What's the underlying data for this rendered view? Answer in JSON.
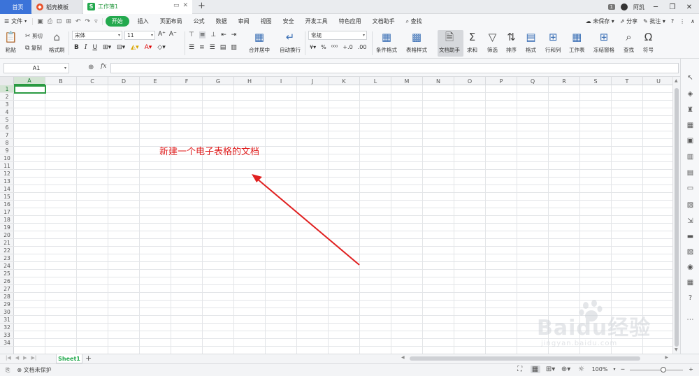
{
  "titlebar": {
    "tabs": [
      {
        "label": "首页"
      },
      {
        "label": "稻壳模板"
      },
      {
        "label": "工作簿1"
      }
    ],
    "page_badge": "1",
    "user_name": "阿凯"
  },
  "menubar": {
    "file": "文件",
    "start": "开始",
    "items": [
      "插入",
      "页面布局",
      "公式",
      "数据",
      "审阅",
      "视图",
      "安全",
      "开发工具",
      "特色应用",
      "文档助手"
    ],
    "search": "查找",
    "unsaved": "未保存",
    "share": "分享",
    "comment": "批注"
  },
  "ribbon": {
    "paste": "粘贴",
    "cut": "剪切",
    "copy": "复制",
    "format_painter": "格式刷",
    "font_name": "宋体",
    "font_size": "11",
    "merge_center": "合并居中",
    "wrap_text": "自动换行",
    "number_format": "常规",
    "conditional_format": "条件格式",
    "table_style": "表格样式",
    "doc_helper": "文档助手",
    "sum": "求和",
    "filter": "筛选",
    "sort": "排序",
    "format": "格式",
    "row_col": "行和列",
    "worksheet": "工作表",
    "freeze": "冻结窗格",
    "find": "查找",
    "symbol": "符号"
  },
  "formula": {
    "name_box": "A1",
    "fx": "fx",
    "value": ""
  },
  "sheet": {
    "columns": [
      "A",
      "B",
      "C",
      "D",
      "E",
      "F",
      "G",
      "H",
      "I",
      "J",
      "K",
      "L",
      "M",
      "N",
      "O",
      "P",
      "Q",
      "R",
      "S",
      "T",
      "U"
    ],
    "rows": [
      "1",
      "2",
      "3",
      "4",
      "5",
      "6",
      "7",
      "8",
      "9",
      "10",
      "11",
      "12",
      "13",
      "14",
      "15",
      "16",
      "17",
      "18",
      "19",
      "20",
      "21",
      "22",
      "23",
      "24",
      "25",
      "26",
      "27",
      "28",
      "29",
      "30",
      "31",
      "32",
      "33",
      "34"
    ],
    "active_cell": "A1",
    "annotation": "新建一个电子表格的文档",
    "annotation_color": "#e02020",
    "accent_color": "#23a94e"
  },
  "sheet_tabs": {
    "tabs": [
      "Sheet1"
    ]
  },
  "status": {
    "protect": "文档未保护",
    "zoom": "100%",
    "zoom_level": 1.0
  },
  "watermark": {
    "logo": "Baidu经验",
    "url": "jingyan.baidu.com"
  }
}
